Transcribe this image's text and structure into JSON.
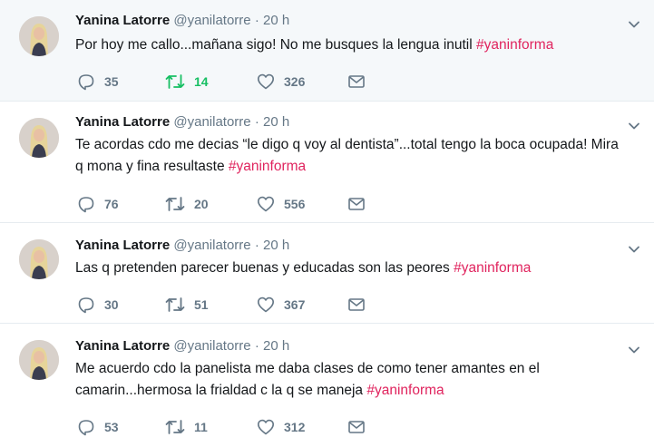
{
  "tweets": [
    {
      "name": "Yanina Latorre",
      "handle": "@yanilatorre",
      "separator": "·",
      "time": "20 h",
      "text": "Por hoy me callo...mañana sigo! No me busques la lengua inutil",
      "hashtag": "#yaninforma",
      "replies": "35",
      "retweets": "14",
      "likes": "326",
      "retweeted": true
    },
    {
      "name": "Yanina Latorre",
      "handle": "@yanilatorre",
      "separator": "·",
      "time": "20 h",
      "text": "Te acordas cdo me decias “le digo q voy al dentista”...total tengo la boca ocupada! Mira q mona y fina resultaste",
      "hashtag": "#yaninforma",
      "replies": "76",
      "retweets": "20",
      "likes": "556",
      "retweeted": false
    },
    {
      "name": "Yanina Latorre",
      "handle": "@yanilatorre",
      "separator": "·",
      "time": "20 h",
      "text": "Las q pretenden parecer buenas y educadas son las peores",
      "hashtag": "#yaninforma",
      "replies": "30",
      "retweets": "51",
      "likes": "367",
      "retweeted": false
    },
    {
      "name": "Yanina Latorre",
      "handle": "@yanilatorre",
      "separator": "·",
      "time": "20 h",
      "text": "Me acuerdo cdo la panelista me daba clases de como tener amantes en el camarin...hermosa la frialdad c la q se maneja",
      "hashtag": "#yaninforma",
      "replies": "53",
      "retweets": "11",
      "likes": "312",
      "retweeted": false
    }
  ],
  "colors": {
    "hashtag": "#e0245e",
    "retweet_active": "#17bf63",
    "muted": "#657786",
    "highlight_bg": "#f5f8fa"
  },
  "icons": [
    "reply-icon",
    "retweet-icon",
    "like-icon",
    "direct-message-icon",
    "chevron-down-icon",
    "avatar"
  ]
}
